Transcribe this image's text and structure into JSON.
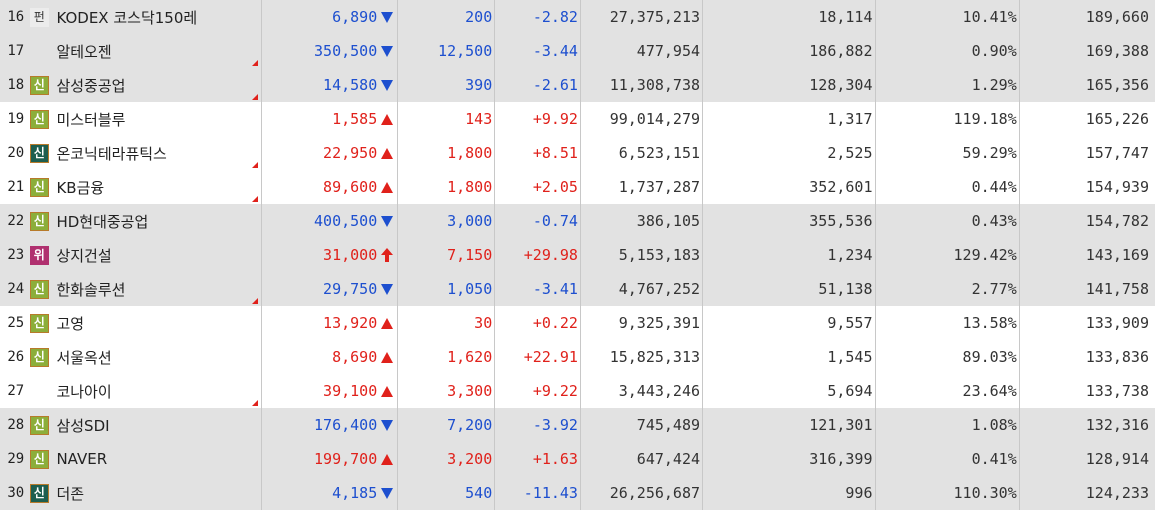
{
  "colors": {
    "up": "#e0211b",
    "down": "#1d4fcf",
    "row_alt": "#e2e2e2"
  },
  "rows": [
    {
      "rank": "16",
      "badge": "펀",
      "badge_type": "pyeon",
      "name": "KODEX 코스닥150레",
      "price": "6,890",
      "dir": "down",
      "change": "200",
      "rate": "-2.82",
      "volume": "27,375,213",
      "vol2": "18,114",
      "pct": "10.41%",
      "amt": "189,660",
      "flag": false,
      "gray": true
    },
    {
      "rank": "17",
      "badge": "",
      "badge_type": "none",
      "name": "알테오젠",
      "price": "350,500",
      "dir": "down",
      "change": "12,500",
      "rate": "-3.44",
      "volume": "477,954",
      "vol2": "186,882",
      "pct": "0.90%",
      "amt": "169,388",
      "flag": true,
      "gray": true
    },
    {
      "rank": "18",
      "badge": "신",
      "badge_type": "shin",
      "name": "삼성중공업",
      "price": "14,580",
      "dir": "down",
      "change": "390",
      "rate": "-2.61",
      "volume": "11,308,738",
      "vol2": "128,304",
      "pct": "1.29%",
      "amt": "165,356",
      "flag": true,
      "gray": true
    },
    {
      "rank": "19",
      "badge": "신",
      "badge_type": "shin",
      "name": "미스터블루",
      "price": "1,585",
      "dir": "up",
      "change": "143",
      "rate": "+9.92",
      "volume": "99,014,279",
      "vol2": "1,317",
      "pct": "119.18%",
      "amt": "165,226",
      "flag": false,
      "gray": false
    },
    {
      "rank": "20",
      "badge": "신",
      "badge_type": "shin-dark",
      "name": "온코닉테라퓨틱스",
      "price": "22,950",
      "dir": "up",
      "change": "1,800",
      "rate": "+8.51",
      "volume": "6,523,151",
      "vol2": "2,525",
      "pct": "59.29%",
      "amt": "157,747",
      "flag": true,
      "gray": false
    },
    {
      "rank": "21",
      "badge": "신",
      "badge_type": "shin",
      "name": "KB금융",
      "price": "89,600",
      "dir": "up",
      "change": "1,800",
      "rate": "+2.05",
      "volume": "1,737,287",
      "vol2": "352,601",
      "pct": "0.44%",
      "amt": "154,939",
      "flag": true,
      "gray": false
    },
    {
      "rank": "22",
      "badge": "신",
      "badge_type": "shin",
      "name": "HD현대중공업",
      "price": "400,500",
      "dir": "down",
      "change": "3,000",
      "rate": "-0.74",
      "volume": "386,105",
      "vol2": "355,536",
      "pct": "0.43%",
      "amt": "154,782",
      "flag": false,
      "gray": true
    },
    {
      "rank": "23",
      "badge": "위",
      "badge_type": "wi",
      "name": "상지건설",
      "price": "31,000",
      "dir": "limit-up",
      "change": "7,150",
      "rate": "+29.98",
      "volume": "5,153,183",
      "vol2": "1,234",
      "pct": "129.42%",
      "amt": "143,169",
      "flag": false,
      "gray": true
    },
    {
      "rank": "24",
      "badge": "신",
      "badge_type": "shin",
      "name": "한화솔루션",
      "price": "29,750",
      "dir": "down",
      "change": "1,050",
      "rate": "-3.41",
      "volume": "4,767,252",
      "vol2": "51,138",
      "pct": "2.77%",
      "amt": "141,758",
      "flag": true,
      "gray": true
    },
    {
      "rank": "25",
      "badge": "신",
      "badge_type": "shin",
      "name": "고영",
      "price": "13,920",
      "dir": "up",
      "change": "30",
      "rate": "+0.22",
      "volume": "9,325,391",
      "vol2": "9,557",
      "pct": "13.58%",
      "amt": "133,909",
      "flag": false,
      "gray": false
    },
    {
      "rank": "26",
      "badge": "신",
      "badge_type": "shin",
      "name": "서울옥션",
      "price": "8,690",
      "dir": "up",
      "change": "1,620",
      "rate": "+22.91",
      "volume": "15,825,313",
      "vol2": "1,545",
      "pct": "89.03%",
      "amt": "133,836",
      "flag": false,
      "gray": false
    },
    {
      "rank": "27",
      "badge": "",
      "badge_type": "none",
      "name": "코나아이",
      "price": "39,100",
      "dir": "up",
      "change": "3,300",
      "rate": "+9.22",
      "volume": "3,443,246",
      "vol2": "5,694",
      "pct": "23.64%",
      "amt": "133,738",
      "flag": true,
      "gray": false
    },
    {
      "rank": "28",
      "badge": "신",
      "badge_type": "shin",
      "name": "삼성SDI",
      "price": "176,400",
      "dir": "down",
      "change": "7,200",
      "rate": "-3.92",
      "volume": "745,489",
      "vol2": "121,301",
      "pct": "1.08%",
      "amt": "132,316",
      "flag": false,
      "gray": true
    },
    {
      "rank": "29",
      "badge": "신",
      "badge_type": "shin",
      "name": "NAVER",
      "price": "199,700",
      "dir": "up",
      "change": "3,200",
      "rate": "+1.63",
      "volume": "647,424",
      "vol2": "316,399",
      "pct": "0.41%",
      "amt": "128,914",
      "flag": false,
      "gray": true
    },
    {
      "rank": "30",
      "badge": "신",
      "badge_type": "shin-dark",
      "name": "더존",
      "price": "4,185",
      "dir": "down",
      "change": "540",
      "rate": "-11.43",
      "volume": "26,256,687",
      "vol2": "996",
      "pct": "110.30%",
      "amt": "124,233",
      "flag": false,
      "gray": true
    }
  ]
}
